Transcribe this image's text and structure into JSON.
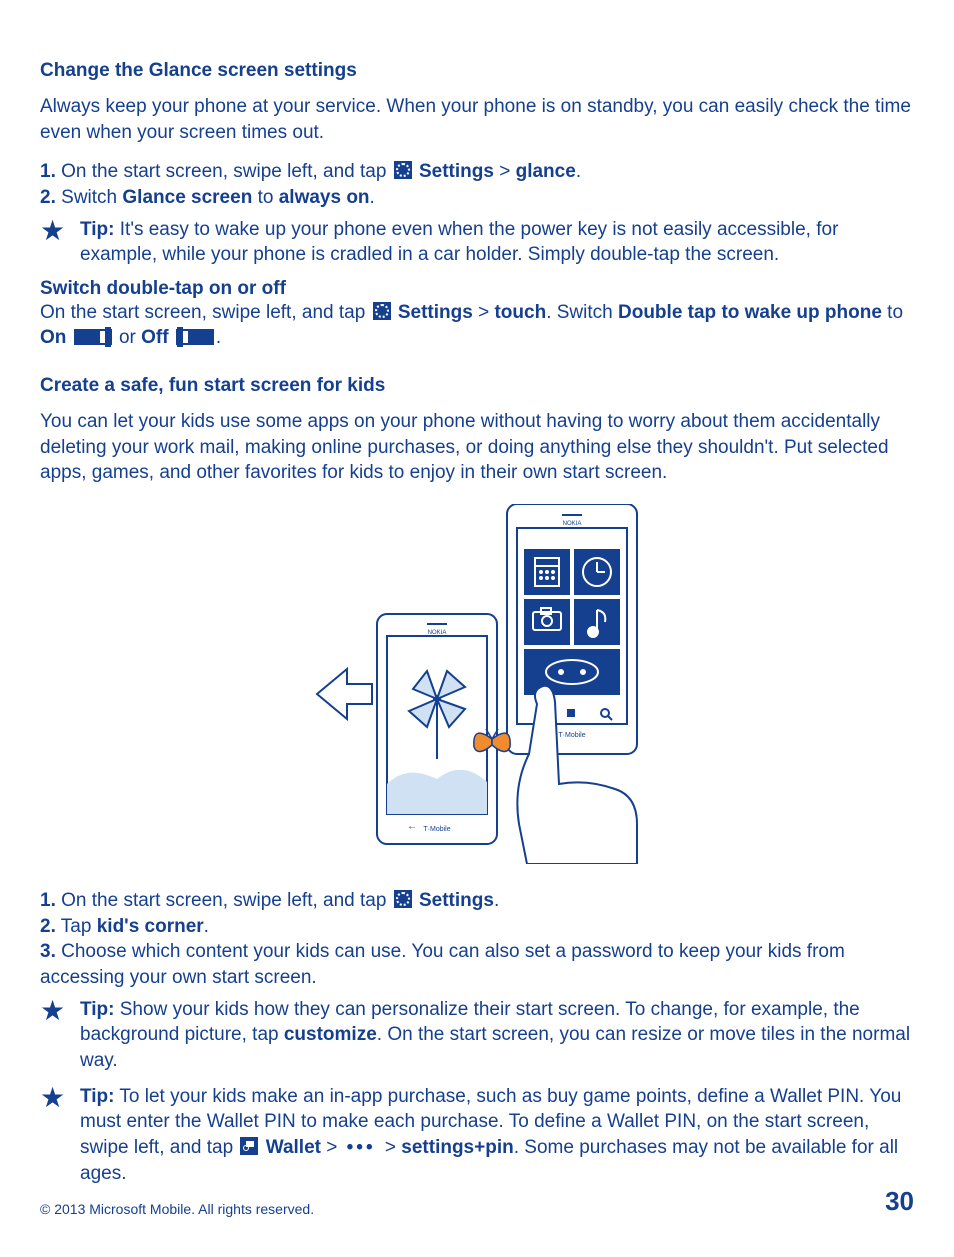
{
  "heading1": "Change the Glance screen settings",
  "intro1": "Always keep your phone at your service. When your phone is on standby, you can easily check the time even when your screen times out.",
  "step1_1_pre": "On the start screen, swipe left, and tap ",
  "step1_1_settings": "Settings",
  "gt": ">",
  "glance": "glance",
  "step1_2_a": "Switch ",
  "glancescreen": "Glance screen",
  "step1_2_b": " to ",
  "alwayson": "always on",
  "tip_label": "Tip:",
  "tip1": " It's easy to wake up your phone even when the power key is not easily accessible, for example, while your phone is cradled in a car holder. Simply double-tap the screen.",
  "subhead1": "Switch double-tap on or off",
  "sw_a": "On the start screen, swipe left, and tap ",
  "sw_settings": "Settings",
  "sw_touch": "touch",
  "sw_b": ". Switch ",
  "dbltap": "Double tap to wake up phone",
  "sw_c": " to ",
  "on": "On",
  "sw_or": " or ",
  "off": "Off",
  "heading2": "Create a safe, fun start screen for kids",
  "intro2": "You can let your kids use some apps on your phone without having to worry about them accidentally deleting your work mail, making online purchases, or doing anything else they shouldn't. Put selected apps, games, and other favorites for kids to enjoy in their own start screen.",
  "kstep1_a": "On the start screen, swipe left, and tap ",
  "kstep1_settings": "Settings",
  "kstep2_a": "Tap ",
  "kidscorner": "kid's corner",
  "kstep3": "Choose which content your kids can use. You can also set a password to keep your kids from accessing your own start screen.",
  "tip2a": " Show your kids how they can personalize their start screen. To change, for example, the background picture, tap ",
  "customize": "customize",
  "tip2b": ". On the start screen, you can resize or move tiles in the normal way.",
  "tip3a": " To let your kids make an in-app purchase, such as buy game points, define a Wallet PIN. You must enter the Wallet PIN to make each purchase. To define a Wallet PIN, on the start screen, swipe left, and tap ",
  "wallet": "Wallet",
  "settingspin": "settings+pin",
  "tip3b": ". Some purchases may not be available for all ages.",
  "dots": "•••",
  "copyright": "© 2013 Microsoft Mobile. All rights reserved.",
  "pagenum": "30",
  "period": "."
}
